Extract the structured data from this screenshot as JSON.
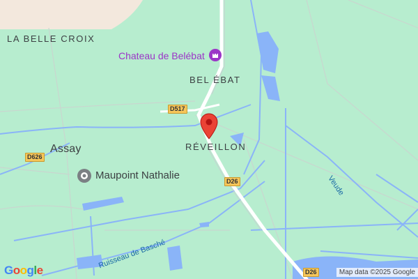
{
  "places": {
    "la_belle_croix": "LA BELLE CROIX",
    "bel_ebat": "BEL ÉBAT",
    "reveillon": "RÉVEILLON",
    "assay": "Assay"
  },
  "pois": {
    "chateau": "Chateau de Belébat",
    "maupoint": "Maupoint Nathalie"
  },
  "roads": {
    "d517": "D517",
    "d626": "D626",
    "d26_a": "D26",
    "d26_b": "D26"
  },
  "waterways": {
    "veude": "Veude",
    "ruisseau": "Ruisseau de Basché"
  },
  "footer": {
    "logo": "Google",
    "attribution": "Map data ©2025 Google"
  },
  "colors": {
    "land": "#b7edcf",
    "water": "#8ab4f8",
    "road": "#ffffff",
    "urban": "#f5e9dc",
    "pin": "#ea4335",
    "poi": "#9b35c7"
  },
  "icons": {
    "pin": "map-pin-icon",
    "castle": "castle-icon",
    "place": "place-marker-icon"
  }
}
